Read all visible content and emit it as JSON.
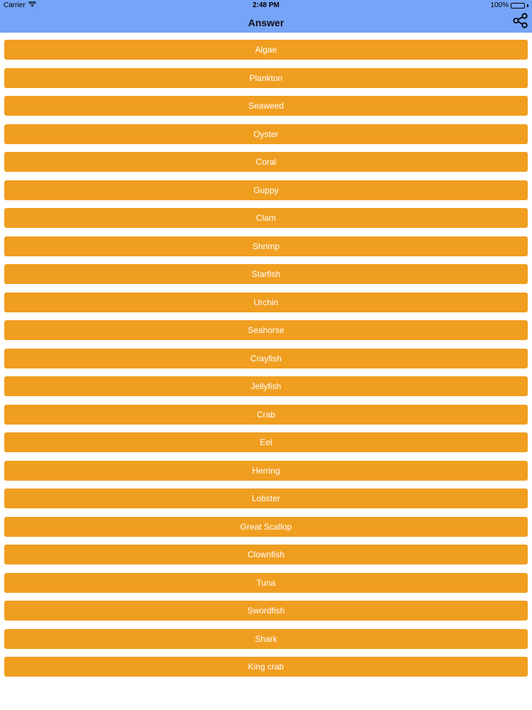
{
  "status_bar": {
    "carrier": "Carrier",
    "time": "2:48 PM",
    "battery": "100%",
    "wifi_icon": "wifi-icon",
    "battery_icon": "battery-icon"
  },
  "nav": {
    "title": "Answer",
    "share_icon": "share-icon"
  },
  "colors": {
    "nav_background": "#76a4f7",
    "button_background": "#f09e20",
    "button_text": "#ffffff"
  },
  "answers": [
    "Algae",
    "Plankton",
    "Seaweed",
    "Oyster",
    "Coral",
    "Guppy",
    "Clam",
    "Shrimp",
    "Starfish",
    "Urchin",
    "Seahorse",
    "Crayfish",
    "Jellyfish",
    "Crab",
    "Eel",
    "Herring",
    "Lobster",
    "Great Scallop",
    "Clownfish",
    "Tuna",
    "Swordfish",
    "Shark",
    "King crab"
  ]
}
